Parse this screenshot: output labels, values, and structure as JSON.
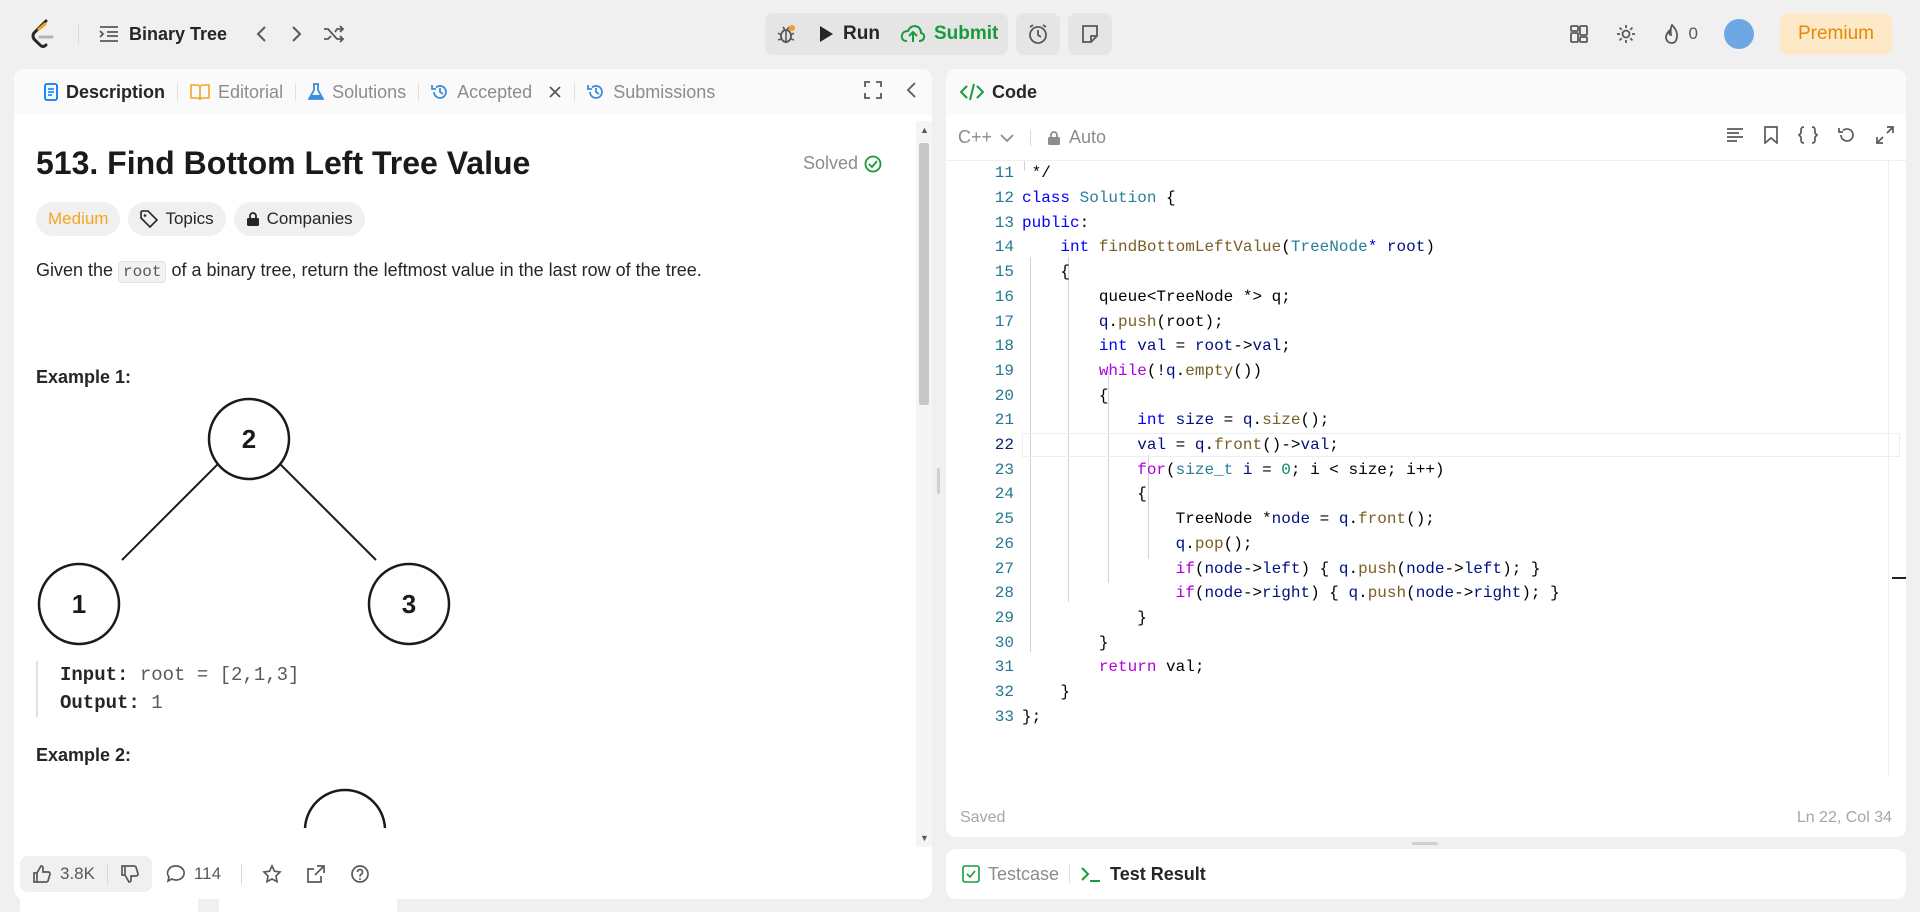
{
  "topbar": {
    "problem_list_label": "Binary Tree",
    "run_label": "Run",
    "submit_label": "Submit",
    "streak_count": "0",
    "premium_label": "Premium"
  },
  "left_tabs": {
    "description": "Description",
    "editorial": "Editorial",
    "solutions": "Solutions",
    "accepted": "Accepted",
    "submissions": "Submissions"
  },
  "problem": {
    "title": "513. Find Bottom Left Tree Value",
    "status": "Solved",
    "difficulty": "Medium",
    "topics_label": "Topics",
    "companies_label": "Companies",
    "statement_pre": "Given the ",
    "statement_code": "root",
    "statement_post": " of a binary tree, return the leftmost value in the last row of the tree.",
    "example1_title": "Example 1:",
    "example1_input_label": "Input:",
    "example1_input_value": " root = [2,1,3]",
    "example1_output_label": "Output:",
    "example1_output_value": " 1",
    "example2_title": "Example 2:",
    "tree_nodes": [
      "2",
      "1",
      "3"
    ]
  },
  "bottom_bar": {
    "likes": "3.8K",
    "comments": "114"
  },
  "code_panel": {
    "header": "Code",
    "language": "C++",
    "mode": "Auto",
    "status": "Saved",
    "cursor": "Ln 22, Col 34",
    "line_numbers": [
      "11",
      "12",
      "13",
      "14",
      "15",
      "16",
      "17",
      "18",
      "19",
      "20",
      "21",
      "22",
      "23",
      "24",
      "25",
      "26",
      "27",
      "28",
      "29",
      "30",
      "31",
      "32",
      "33"
    ],
    "current_line": "22"
  },
  "test_panel": {
    "testcase_label": "Testcase",
    "result_label": "Test Result"
  },
  "colors": {
    "accent_green": "#1a9a3c",
    "medium_orange": "#f5a623",
    "premium_bg": "#fde8c8"
  }
}
